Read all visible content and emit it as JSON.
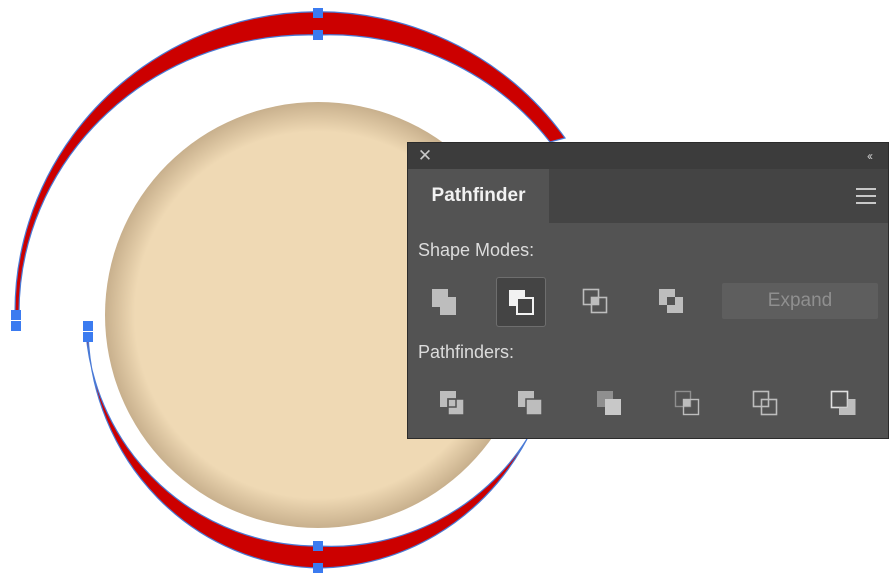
{
  "panel": {
    "close_glyph": "✕",
    "collapse_glyph": "‹‹",
    "tab_label": "Pathfinder",
    "shape_modes_label": "Shape Modes:",
    "pathfinders_label": "Pathfinders:",
    "expand_label": "Expand",
    "shape_modes": [
      {
        "icon": "unite-icon",
        "selected": false
      },
      {
        "icon": "minus-front-icon",
        "selected": true
      },
      {
        "icon": "intersect-icon",
        "selected": false
      },
      {
        "icon": "exclude-icon",
        "selected": false
      }
    ],
    "pathfinders": [
      {
        "icon": "divide-icon"
      },
      {
        "icon": "trim-icon"
      },
      {
        "icon": "merge-icon"
      },
      {
        "icon": "crop-icon"
      },
      {
        "icon": "outline-icon"
      },
      {
        "icon": "minus-back-icon"
      }
    ]
  },
  "colors": {
    "stroke_red": "#cc0000",
    "path_outline": "#4a7ad6",
    "anchor": "#3b7bf0",
    "circle_fill": "#efd9b4",
    "panel_bg": "#535353"
  }
}
